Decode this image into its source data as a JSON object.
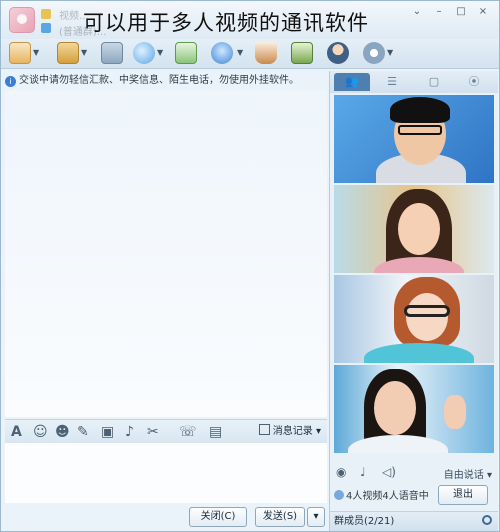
{
  "overlay_caption": "可以用于多人视频的通讯软件",
  "titlebar": {
    "title_line1": "视频...",
    "title_line2": "(普通群)...",
    "controls": [
      "⌄",
      "–",
      "□",
      "×"
    ]
  },
  "toolbar": {
    "icons": [
      "home-icon",
      "folder-icon",
      "app-icon",
      "voice-call-icon",
      "note-icon",
      "video-call-icon",
      "cup-icon",
      "tv-icon",
      "contact-icon",
      "settings-icon"
    ]
  },
  "chat": {
    "notice_text": "交谈中请勿轻信汇款、中奖信息、陌生电话，勿使用外挂软件。",
    "history_label": "消息记录",
    "close_label": "关闭(C)",
    "send_label": "发送(S)"
  },
  "format_toolbar": {
    "icons": [
      {
        "name": "font-icon",
        "glyph": "A"
      },
      {
        "name": "emoji-icon",
        "glyph": "☺"
      },
      {
        "name": "magic-face-icon",
        "glyph": "☻"
      },
      {
        "name": "edit-icon",
        "glyph": "✎"
      },
      {
        "name": "image-icon",
        "glyph": "▣"
      },
      {
        "name": "music-icon",
        "glyph": "♪"
      },
      {
        "name": "screenshot-icon",
        "glyph": "✂"
      },
      {
        "name": "voice-message-icon",
        "glyph": "☏"
      },
      {
        "name": "more-icon",
        "glyph": "▤"
      }
    ]
  },
  "right_panel": {
    "tabs": [
      "👥",
      "☰",
      "▢",
      "⦿"
    ],
    "free_talk_label": "自由说话",
    "status_text": "4人视频4人语音中",
    "exit_label": "退出",
    "members_label": "群成员(2/21)"
  },
  "colors": {
    "accent": "#4f7fb0",
    "titlebar": "#dfeaf4",
    "chat_bg": "#eef5fb"
  }
}
